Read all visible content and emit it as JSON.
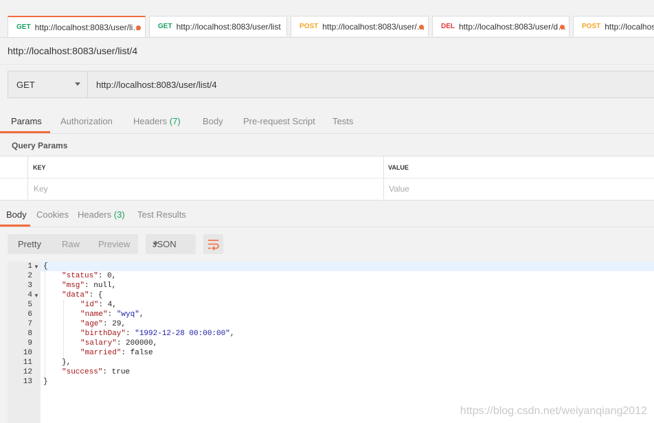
{
  "tabs": [
    {
      "method": "GET",
      "url": "http://localhost:8083/user/li…",
      "dot": true
    },
    {
      "method": "GET",
      "url": "http://localhost:8083/user/list",
      "dot": false
    },
    {
      "method": "POST",
      "url": "http://localhost:8083/user/…",
      "dot": true
    },
    {
      "method": "DEL",
      "url": "http://localhost:8083/user/d…",
      "dot": true
    },
    {
      "method": "POST",
      "url": "http://localhost",
      "dot": false
    }
  ],
  "request": {
    "title": "http://localhost:8083/user/list/4",
    "method": "GET",
    "url": "http://localhost:8083/user/list/4"
  },
  "request_tabs": {
    "params": "Params",
    "authorization": "Authorization",
    "headers": "Headers",
    "headers_count": "(7)",
    "body": "Body",
    "prerequest": "Pre-request Script",
    "tests": "Tests"
  },
  "query_params": {
    "title": "Query Params",
    "key_header": "KEY",
    "value_header": "VALUE",
    "key_placeholder": "Key",
    "value_placeholder": "Value"
  },
  "response_tabs": {
    "body": "Body",
    "cookies": "Cookies",
    "headers": "Headers",
    "headers_count": "(3)",
    "test_results": "Test Results"
  },
  "view_modes": {
    "pretty": "Pretty",
    "raw": "Raw",
    "preview": "Preview",
    "format": "JSON"
  },
  "response_lines": [
    {
      "n": "1",
      "fold": true,
      "indent": 0,
      "parts": [
        {
          "t": "p",
          "v": "{"
        }
      ]
    },
    {
      "n": "2",
      "indent": 1,
      "parts": [
        {
          "t": "k",
          "v": "\"status\""
        },
        {
          "t": "p",
          "v": ": 0,"
        }
      ]
    },
    {
      "n": "3",
      "indent": 1,
      "parts": [
        {
          "t": "k",
          "v": "\"msg\""
        },
        {
          "t": "p",
          "v": ": null,"
        }
      ]
    },
    {
      "n": "4",
      "fold": true,
      "indent": 1,
      "parts": [
        {
          "t": "k",
          "v": "\"data\""
        },
        {
          "t": "p",
          "v": ": {"
        }
      ]
    },
    {
      "n": "5",
      "indent": 2,
      "parts": [
        {
          "t": "k",
          "v": "\"id\""
        },
        {
          "t": "p",
          "v": ": 4,"
        }
      ]
    },
    {
      "n": "6",
      "indent": 2,
      "parts": [
        {
          "t": "k",
          "v": "\"name\""
        },
        {
          "t": "p",
          "v": ": "
        },
        {
          "t": "s",
          "v": "\"wyq\""
        },
        {
          "t": "p",
          "v": ","
        }
      ]
    },
    {
      "n": "7",
      "indent": 2,
      "parts": [
        {
          "t": "k",
          "v": "\"age\""
        },
        {
          "t": "p",
          "v": ": 29,"
        }
      ]
    },
    {
      "n": "8",
      "indent": 2,
      "parts": [
        {
          "t": "k",
          "v": "\"birthDay\""
        },
        {
          "t": "p",
          "v": ": "
        },
        {
          "t": "s",
          "v": "\"1992-12-28 00:00:00\""
        },
        {
          "t": "p",
          "v": ","
        }
      ]
    },
    {
      "n": "9",
      "indent": 2,
      "parts": [
        {
          "t": "k",
          "v": "\"salary\""
        },
        {
          "t": "p",
          "v": ": 200000,"
        }
      ]
    },
    {
      "n": "10",
      "indent": 2,
      "parts": [
        {
          "t": "k",
          "v": "\"married\""
        },
        {
          "t": "p",
          "v": ": false"
        }
      ]
    },
    {
      "n": "11",
      "indent": 1,
      "parts": [
        {
          "t": "p",
          "v": "},"
        }
      ]
    },
    {
      "n": "12",
      "indent": 1,
      "parts": [
        {
          "t": "k",
          "v": "\"success\""
        },
        {
          "t": "p",
          "v": ": true"
        }
      ]
    },
    {
      "n": "13",
      "indent": 0,
      "parts": [
        {
          "t": "p",
          "v": "}"
        }
      ]
    }
  ],
  "watermark": "https://blog.csdn.net/weiyanqiang2012",
  "colors": {
    "accent": "#f26b3a",
    "get": "#1aa260",
    "post": "#f5a623",
    "delete": "#e0393e",
    "json_key": "#a31515",
    "json_string": "#1a1aa6"
  },
  "icons": {
    "dropdown": "chevron-down-icon",
    "wrap": "wrap-lines-icon",
    "fold": "fold-arrow-icon",
    "unsaved": "unsaved-dot-icon"
  }
}
